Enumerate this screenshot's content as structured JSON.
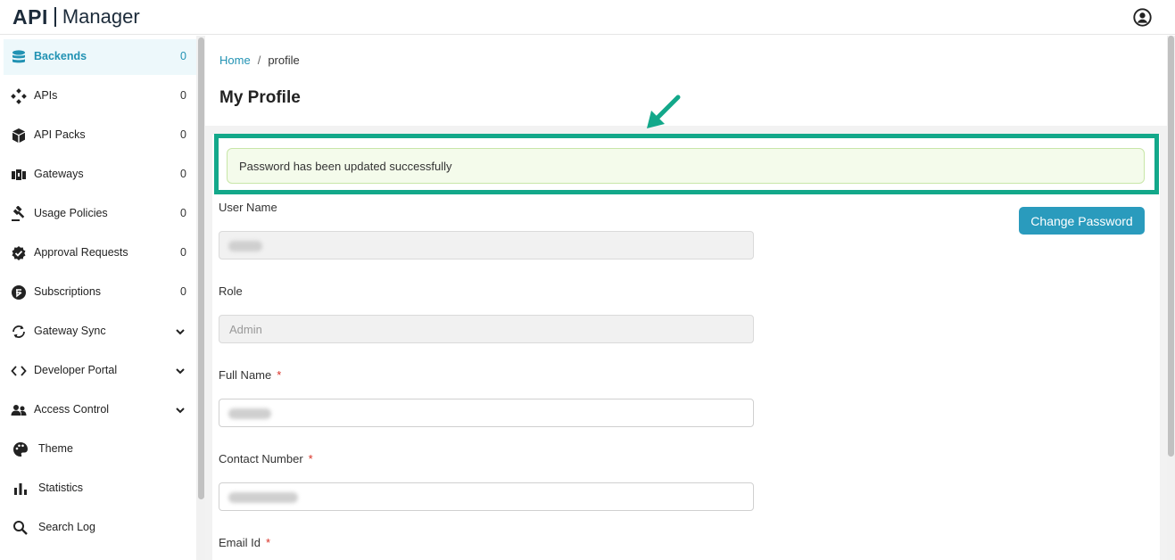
{
  "header": {
    "logo_api": "API",
    "logo_manager": "Manager",
    "user_icon": "user-circle-icon"
  },
  "sidebar": {
    "items": [
      {
        "label": "Backends",
        "count": "0",
        "icon": "database-icon",
        "active": true
      },
      {
        "label": "APIs",
        "count": "0",
        "icon": "api-diamond-icon"
      },
      {
        "label": "API Packs",
        "count": "0",
        "icon": "package-icon"
      },
      {
        "label": "Gateways",
        "count": "0",
        "icon": "gateway-icon"
      },
      {
        "label": "Usage Policies",
        "count": "0",
        "icon": "gavel-icon"
      },
      {
        "label": "Approval Requests",
        "count": "0",
        "icon": "badge-check-icon"
      },
      {
        "label": "Subscriptions",
        "count": "0",
        "icon": "subscription-icon"
      },
      {
        "label": "Gateway Sync",
        "icon": "sync-icon",
        "expandable": true
      },
      {
        "label": "Developer Portal",
        "icon": "code-icon",
        "expandable": true
      },
      {
        "label": "Access Control",
        "icon": "users-icon",
        "expandable": true
      },
      {
        "label": "Theme",
        "icon": "palette-icon"
      },
      {
        "label": "Statistics",
        "icon": "bar-chart-icon"
      },
      {
        "label": "Search Log",
        "icon": "search-icon"
      }
    ]
  },
  "breadcrumb": {
    "home": "Home",
    "separator": "/",
    "current": "profile"
  },
  "page": {
    "title": "My Profile"
  },
  "alert": {
    "message": "Password has been updated successfully"
  },
  "actions": {
    "change_password": "Change Password"
  },
  "form": {
    "user_name": {
      "label": "User Name"
    },
    "role": {
      "label": "Role",
      "value": "Admin"
    },
    "full_name": {
      "label": "Full Name",
      "required": "*"
    },
    "contact_number": {
      "label": "Contact Number",
      "required": "*"
    },
    "email_id": {
      "label": "Email Id",
      "required": "*"
    }
  },
  "colors": {
    "accent": "#2192b3",
    "button": "#2a9bbd",
    "highlight": "#13a88a",
    "alert_bg": "#f4fbeb"
  }
}
